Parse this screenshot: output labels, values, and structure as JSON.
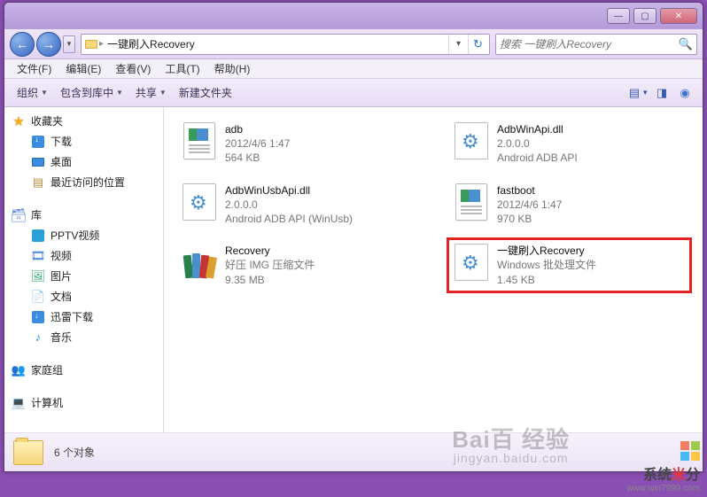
{
  "titlebar": {
    "min": "—",
    "max": "▢",
    "close": "✕"
  },
  "nav": {
    "back": "←",
    "fwd": "→",
    "path": "一键刷入Recovery",
    "dropdown": "▾",
    "refresh": "↻",
    "search_placeholder": "搜索 一键刷入Recovery"
  },
  "menu": {
    "file": "文件(F)",
    "edit": "编辑(E)",
    "view": "查看(V)",
    "tools": "工具(T)",
    "help": "帮助(H)"
  },
  "toolbar": {
    "organize": "组织",
    "include": "包含到库中",
    "share": "共享",
    "newfolder": "新建文件夹"
  },
  "sidebar": {
    "fav": "收藏夹",
    "downloads": "下载",
    "desktop": "桌面",
    "recent": "最近访问的位置",
    "lib": "库",
    "pptv": "PPTV视频",
    "video": "视频",
    "pictures": "图片",
    "docs": "文档",
    "xunlei": "迅雷下载",
    "music": "音乐",
    "homegroup": "家庭组",
    "computer": "计算机"
  },
  "files": [
    {
      "name": "adb",
      "line2": "2012/4/6 1:47",
      "line3": "564 KB",
      "icon": "doc"
    },
    {
      "name": "AdbWinApi.dll",
      "line2": "2.0.0.0",
      "line3": "Android ADB API",
      "icon": "gear"
    },
    {
      "name": "AdbWinUsbApi.dll",
      "line2": "2.0.0.0",
      "line3": "Android ADB API (WinUsb)",
      "icon": "gear"
    },
    {
      "name": "fastboot",
      "line2": "2012/4/6 1:47",
      "line3": "970 KB",
      "icon": "doc"
    },
    {
      "name": "Recovery",
      "line2": "好压 IMG 压缩文件",
      "line3": "9.35 MB",
      "icon": "rar"
    },
    {
      "name": "一键刷入Recovery",
      "line2": "Windows 批处理文件",
      "line3": "1.45 KB",
      "icon": "gear",
      "highlight": true
    }
  ],
  "status": {
    "count": "6 个对象"
  },
  "watermark": {
    "baidu": "Bai",
    "du": "百",
    "jy": "经验",
    "url": "jingyan.baidu.com",
    "sys": "系统",
    "fen": "分",
    "sysurl": "www.win7999.com"
  }
}
